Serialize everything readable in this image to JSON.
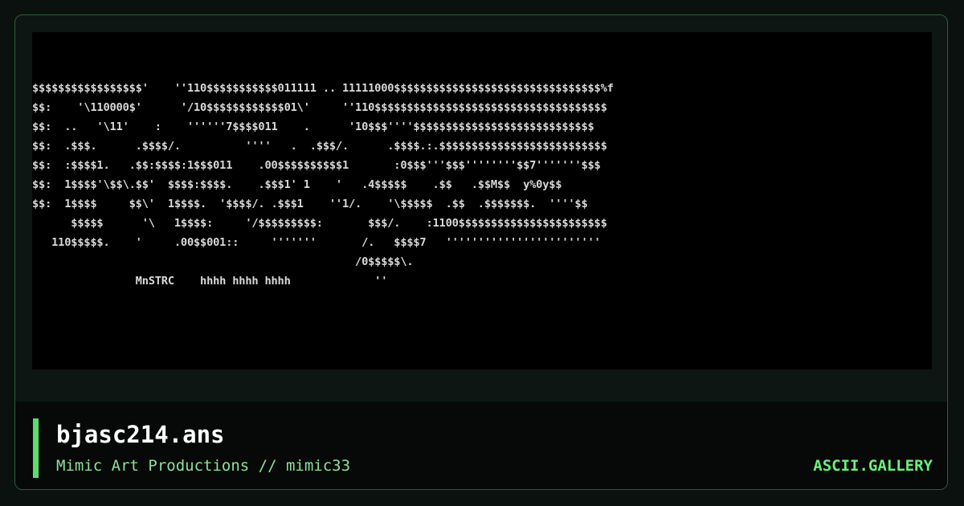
{
  "artwork": {
    "lines": [
      "$$$$$$$$$$$$$$$$$'    ''110$$$$$$$$$$$011111 .. 11111000$$$$$$$$$$$$$$$$$$$$$$$$$$$$$$$$%f",
      "$$:    '\\110000$'      '/10$$$$$$$$$$$$01\\'     ''110$$$$$$$$$$$$$$$$$$$$$$$$$$$$$$$$$$$$",
      "$$:  ..   '\\11'    :    ''''''7$$$$011    .      '10$$$''''$$$$$$$$$$$$$$$$$$$$$$$$$$$$",
      "$$:  .$$$.      .$$$$/.          ''''   .  .$$$/.      .$$$$.:.$$$$$$$$$$$$$$$$$$$$$$$$$$",
      "$$:  :$$$$1.   .$$:$$$$:1$$$011    .00$$$$$$$$$$1       :0$$$'''$$$''''''''$$7'''''''$$$",
      "$$:  1$$$$'\\$$\\.$$'  $$$$:$$$$.    .$$$1' 1    '   .4$$$$$    .$$   .$$M$$  y%0y$$",
      "$$:  1$$$$     $$\\'  1$$$$.  '$$$$/. .$$$1    ''1/.    '\\$$$$$  .$$  .$$$$$$$.  ''''$$",
      "      $$$$$      '\\   1$$$$:     '/$$$$$$$$$:       $$$/.    :1100$$$$$$$$$$$$$$$$$$$$$$$",
      "   110$$$$$.    '     .00$$001::     '''''''       /.   $$$$7   ''''''''''''''''''''''''",
      "                                                  /0$$$$$\\.",
      "                MnSTRC    hhhh hhhh hhhh             ''"
    ]
  },
  "file": {
    "name": "bjasc214.ans",
    "credit": "Mimic Art Productions // mimic33"
  },
  "site": {
    "brand": "ASCII.GALLERY"
  },
  "colors": {
    "accent": "#5ddc6e",
    "brand": "#6cf07a",
    "credit": "#8fe09a",
    "art_text": "#d9d9d9",
    "art_background": "#000000"
  }
}
